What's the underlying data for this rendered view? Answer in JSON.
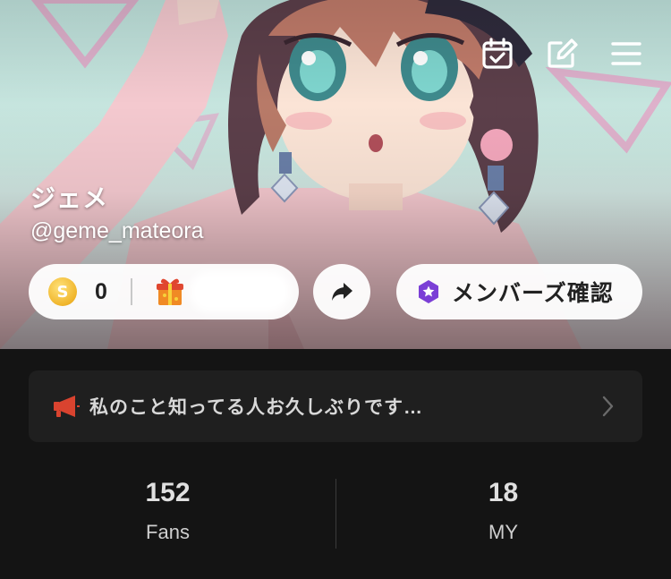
{
  "profile": {
    "name": "ジェメ",
    "handle": "@geme_mateora"
  },
  "header_icons": [
    "calendar-check-icon",
    "edit-icon",
    "menu-icon"
  ],
  "wallet": {
    "coin_count": "0",
    "coin_symbol": "S",
    "gift_icon": "gift-icon"
  },
  "member_button": {
    "label": "メンバーズ確認",
    "icon": "members-badge-icon",
    "icon_color": "#7b3fd6"
  },
  "announcement": {
    "text": "私のこと知ってる人お久しぶりです…",
    "icon": "megaphone-icon",
    "icon_color": "#d9432f"
  },
  "stats": [
    {
      "value": "152",
      "label": "Fans"
    },
    {
      "value": "18",
      "label": "MY"
    }
  ],
  "colors": {
    "background": "#141414",
    "card": "#1f1f1f",
    "pill": "#ffffff",
    "coin": "#f0b52b"
  }
}
